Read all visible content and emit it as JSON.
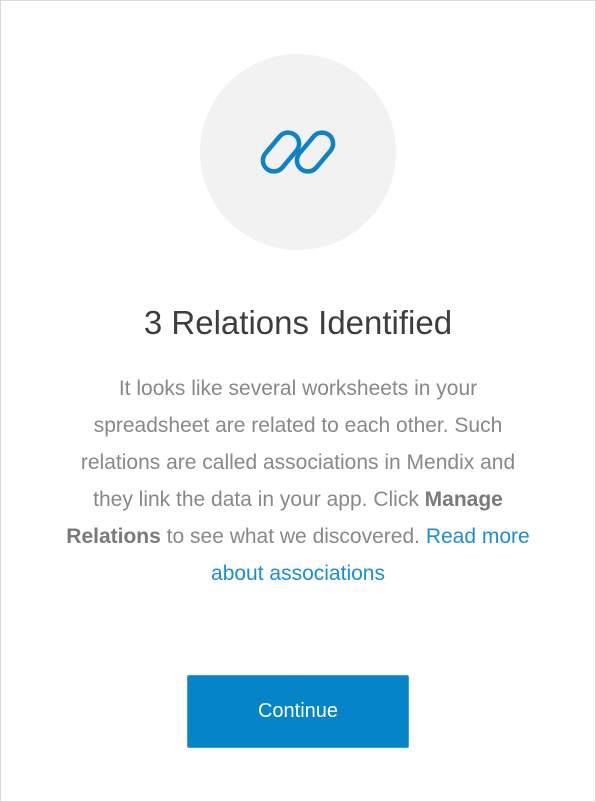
{
  "dialog": {
    "icon": "link-icon",
    "title": "3 Relations Identified",
    "description": {
      "part1": "It looks like several worksheets in your spreadsheet are related to each other. Such relations are called associations in Mendix and they link the data in your app. Click ",
      "bold": "Manage Relations",
      "part2": " to see what we discovered. ",
      "link_text": "Read more about associations"
    },
    "continue_label": "Continue"
  },
  "colors": {
    "accent": "#0585c8",
    "link": "#1a8fd0",
    "icon_bg": "#f2f2f2",
    "title": "#3d3d3d",
    "body_text": "#888888"
  }
}
